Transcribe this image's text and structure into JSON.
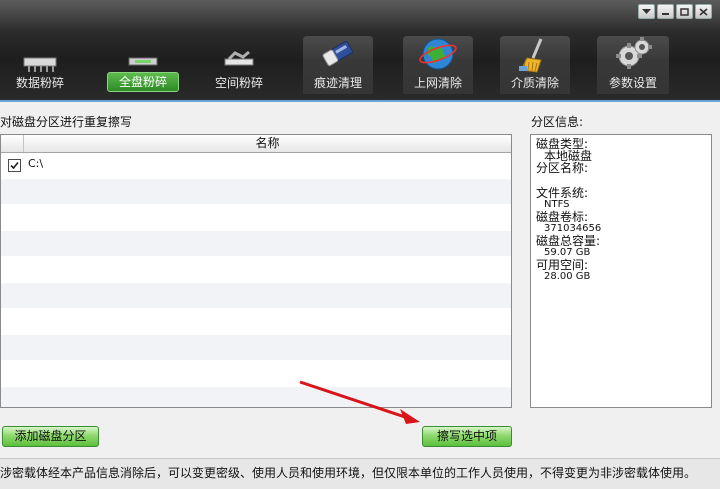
{
  "toolbar": {
    "tabs": [
      {
        "label": "数据粉碎",
        "icon": "data-shred-icon"
      },
      {
        "label": "全盘粉碎",
        "icon": "disk-shred-icon",
        "active": true
      },
      {
        "label": "空间粉碎",
        "icon": "space-shred-icon"
      },
      {
        "label": "痕迹清理",
        "icon": "eraser-icon"
      },
      {
        "label": "上网清除",
        "icon": "globe-icon"
      },
      {
        "label": "介质清除",
        "icon": "broom-icon"
      },
      {
        "label": "参数设置",
        "icon": "gear-icon"
      }
    ]
  },
  "window_controls": [
    "menu-down-icon",
    "minimize-icon",
    "maximize-icon",
    "close-icon"
  ],
  "main": {
    "title": "对磁盘分区进行重复擦写",
    "table": {
      "header": "名称",
      "rows": [
        {
          "checked": true,
          "name": "C:\\"
        }
      ]
    },
    "add_button": "添加磁盘分区",
    "erase_button": "擦写选中项"
  },
  "partition_info": {
    "title": "分区信息:",
    "disk_type_label": "磁盘类型:",
    "disk_type_value": "本地磁盘",
    "partition_name_label": "分区名称:",
    "file_system_label": "文件系统:",
    "file_system_value": "NTFS",
    "volume_id_label": "磁盘卷标:",
    "volume_id_value": "371034656",
    "total_capacity_label": "磁盘总容量:",
    "total_capacity_value": "59.07 GB",
    "free_space_label": "可用空间:",
    "free_space_value": "28.00 GB"
  },
  "status": {
    "text": "涉密载体经本产品信息消除后，可以变更密级、使用人员和使用环境，但仅限本单位的工作人员使用，不得变更为非涉密载体使用。"
  },
  "colors": {
    "accent_green": "#5cbf3c",
    "arrow_red": "#d9141a",
    "header_dark": "#2c2c2c"
  }
}
